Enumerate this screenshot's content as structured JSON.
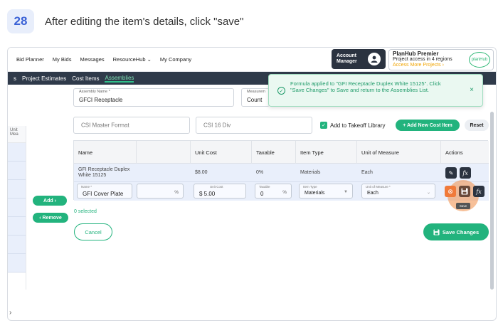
{
  "step": {
    "number": "28",
    "instruction": "After editing the item's details, click \"save\""
  },
  "topnav": {
    "items": [
      "Bid Planner",
      "My Bids",
      "Messages",
      "ResourceHub",
      "My Company"
    ],
    "resourcehub_caret": "⌄",
    "account": "Account\nManager",
    "premium_title": "PlanHub Premier",
    "premium_sub": "Project access in 4 regions",
    "premium_more": "Access More Projects ›",
    "logo": "planHub"
  },
  "subnav": {
    "items": [
      "s",
      "Project Estimates",
      "Cost Items",
      "Assemblies"
    ]
  },
  "left_panel": {
    "col_header": "Unit Mea"
  },
  "add_button": "Add",
  "remove_button": "Remove",
  "form": {
    "assembly_name_label": "Assembly Name *",
    "assembly_name_value": "GFCI Receptacle",
    "measure_label": "Measurem",
    "measure_value": "Count",
    "csi_master_placeholder": "CSI Master Format",
    "csi16_placeholder": "CSI 16 Div",
    "add_to_takeoff": "Add to Takeoff Library",
    "add_new_cost_item": "+ Add New Cost Item",
    "reset": "Reset"
  },
  "table": {
    "headers": [
      "Name",
      "",
      "Unit Cost",
      "Taxable",
      "Item Type",
      "Unit of Measure",
      "Actions"
    ],
    "row1": [
      "GFI Receptacle Duplex White 15125",
      "",
      "$8.00",
      "0%",
      "Materials",
      "Each"
    ],
    "row2": {
      "name_label": "Name *",
      "name_value": "GFI Cover Plate",
      "pct_suffix": "%",
      "unit_cost_label": "Unit Cost",
      "unit_cost_value": "$ 5.00",
      "taxable_label": "Taxable",
      "taxable_value": "0",
      "taxable_suffix": "%",
      "item_type_label": "Item Type",
      "item_type_value": "Materials",
      "uom_label": "Unit of Measure *",
      "uom_value": "Each"
    },
    "save_tooltip": "Save"
  },
  "selected_count": "0 selected",
  "cancel": "Cancel",
  "save_changes": "Save Changes",
  "toast": {
    "message": "Formula applied to \"GFI Receptacle Duplex White 15125\". Click \"Save Changes\" to Save and return to the Assemblies List.",
    "close": "×"
  },
  "bottom_arrow": "›",
  "colors": {
    "accent_green": "#22b37d",
    "nav_dark": "#2f3a4a",
    "row_blue": "#e9effb",
    "highlight": "#f08c46"
  }
}
